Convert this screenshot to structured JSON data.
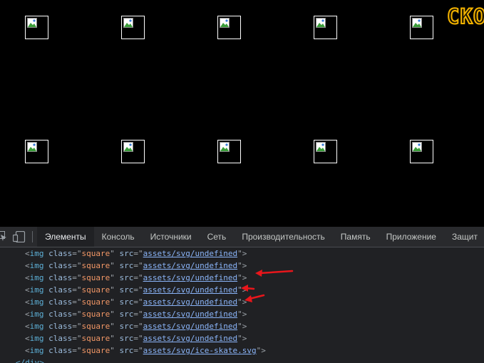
{
  "page": {
    "score_text": "СКО",
    "image_grid_rows": 2,
    "image_grid_cols": 5
  },
  "devtools": {
    "tabs": [
      {
        "label": "Элементы",
        "active": true
      },
      {
        "label": "Консоль",
        "active": false
      },
      {
        "label": "Источники",
        "active": false
      },
      {
        "label": "Сеть",
        "active": false
      },
      {
        "label": "Производительность",
        "active": false
      },
      {
        "label": "Память",
        "active": false
      },
      {
        "label": "Приложение",
        "active": false
      },
      {
        "label": "Защит",
        "active": false
      }
    ],
    "code_lines": [
      {
        "tag": "img",
        "attr1": "class",
        "val1": "square",
        "attr2": "src",
        "link": "assets/svg/undefined"
      },
      {
        "tag": "img",
        "attr1": "class",
        "val1": "square",
        "attr2": "src",
        "link": "assets/svg/undefined"
      },
      {
        "tag": "img",
        "attr1": "class",
        "val1": "square",
        "attr2": "src",
        "link": "assets/svg/undefined"
      },
      {
        "tag": "img",
        "attr1": "class",
        "val1": "square",
        "attr2": "src",
        "link": "assets/svg/undefined"
      },
      {
        "tag": "img",
        "attr1": "class",
        "val1": "square",
        "attr2": "src",
        "link": "assets/svg/undefined"
      },
      {
        "tag": "img",
        "attr1": "class",
        "val1": "square",
        "attr2": "src",
        "link": "assets/svg/undefined"
      },
      {
        "tag": "img",
        "attr1": "class",
        "val1": "square",
        "attr2": "src",
        "link": "assets/svg/undefined"
      },
      {
        "tag": "img",
        "attr1": "class",
        "val1": "square",
        "attr2": "src",
        "link": "assets/svg/undefined"
      },
      {
        "tag": "img",
        "attr1": "class",
        "val1": "square",
        "attr2": "src",
        "link": "assets/svg/ice-skate.svg"
      }
    ],
    "closing_tag": "</div>"
  },
  "colors": {
    "page_bg": "#000000",
    "devtools_bg": "#202124",
    "arrow": "#e8161b",
    "score_outline": "#f5b400"
  },
  "icons": [
    "select-element-icon",
    "device-toolbar-icon",
    "broken-image-icon",
    "annotation-arrow-icon"
  ]
}
